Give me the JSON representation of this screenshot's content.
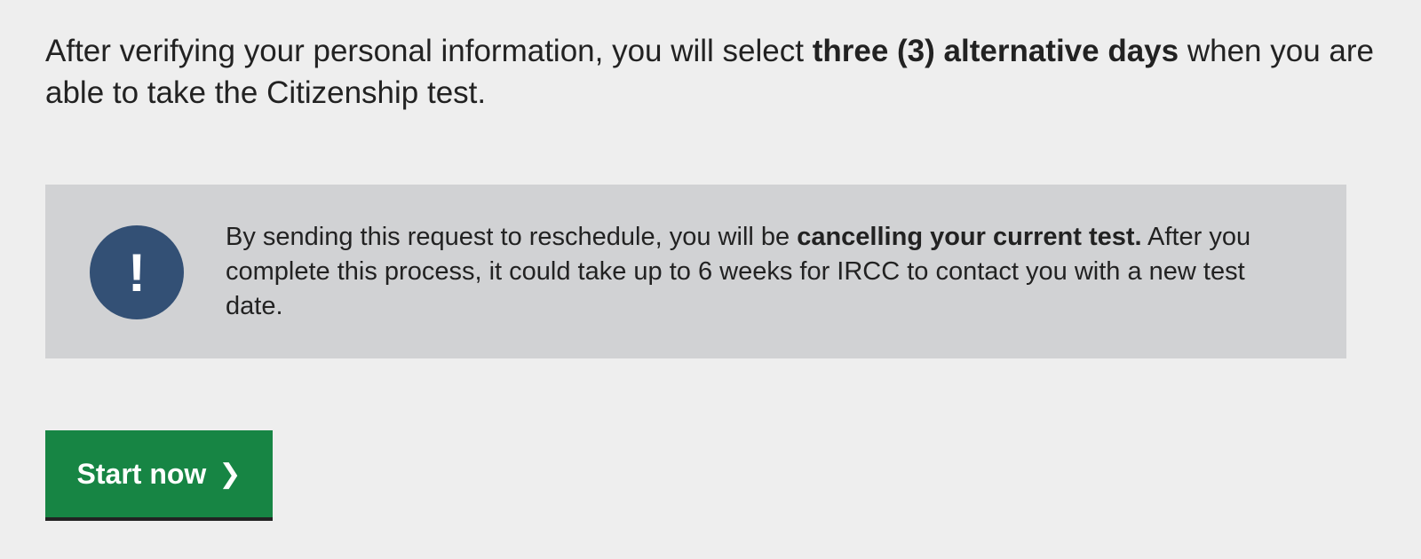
{
  "intro": {
    "text_before": "After verifying your personal information, you will select ",
    "text_bold": "three (3) alternative days",
    "text_after": " when you are able to take the Citizenship test."
  },
  "notice": {
    "icon_glyph": "!",
    "icon": "exclamation-icon",
    "text_before": "By sending this request to reschedule, you will be ",
    "text_bold": "cancelling your current test.",
    "text_after": " After you complete this process, it could take up to 6 weeks for IRCC to contact you with a new test date."
  },
  "start_button": {
    "label": "Start now",
    "chevron": "❯",
    "icon": "chevron-right-icon"
  },
  "colors": {
    "background": "#eeeeee",
    "notice_background": "#d1d2d4",
    "icon_circle": "#335075",
    "button": "#178544",
    "button_border": "#222222",
    "text": "#222222"
  }
}
